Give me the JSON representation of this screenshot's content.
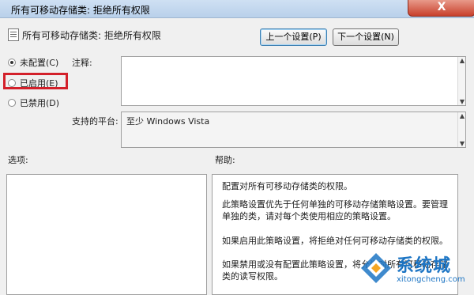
{
  "window": {
    "title": "所有可移动存储类: 拒绝所有权限",
    "close_glyph": "X"
  },
  "header": {
    "title": "所有可移动存储类: 拒绝所有权限"
  },
  "buttons": {
    "prev": "上一个设置(P)",
    "next": "下一个设置(N)"
  },
  "radios": [
    {
      "label": "未配置(C)",
      "checked": true
    },
    {
      "label": "已启用(E)",
      "checked": false
    },
    {
      "label": "已禁用(D)",
      "checked": false
    }
  ],
  "comment": {
    "label": "注释:"
  },
  "platform": {
    "label": "支持的平台:",
    "value": "至少 Windows Vista"
  },
  "options": {
    "label": "选项:"
  },
  "help": {
    "label": "帮助:",
    "paragraphs": [
      "配置对所有可移动存储类的权限。",
      "此策略设置优先于任何单独的可移动存储策略设置。要管理单独的类，请对每个类使用相应的策略设置。",
      "如果启用此策略设置，将拒绝对任何可移动存储类的权限。",
      "如果禁用或没有配置此策略设置，将允许对所有可移动存储类的读写权限。"
    ]
  },
  "watermark": {
    "text": "系统城",
    "url": "xitongcheng.com"
  },
  "colors": {
    "highlight": "#d3202a",
    "brand": "#1d75c4"
  }
}
